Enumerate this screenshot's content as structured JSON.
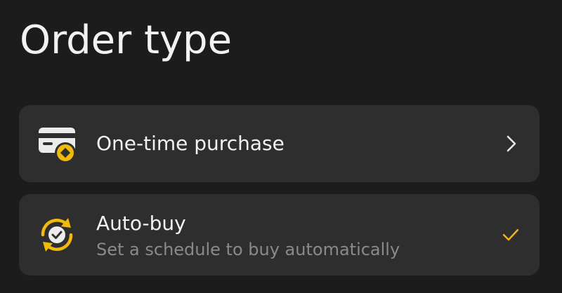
{
  "header": {
    "title": "Order type"
  },
  "options": [
    {
      "label": "One-time purchase",
      "icon": "card-purchase-icon",
      "trailing": "chevron-right-icon"
    },
    {
      "label": "Auto-buy",
      "subtitle": "Set a schedule to buy automatically",
      "icon": "auto-buy-icon",
      "trailing": "check-icon",
      "selected": true
    }
  ],
  "colors": {
    "background": "#1c1c1c",
    "card": "#2e2e2e",
    "accent": "#f0b90b",
    "text": "#f2f2f2",
    "subtext": "#8a8a8a"
  }
}
